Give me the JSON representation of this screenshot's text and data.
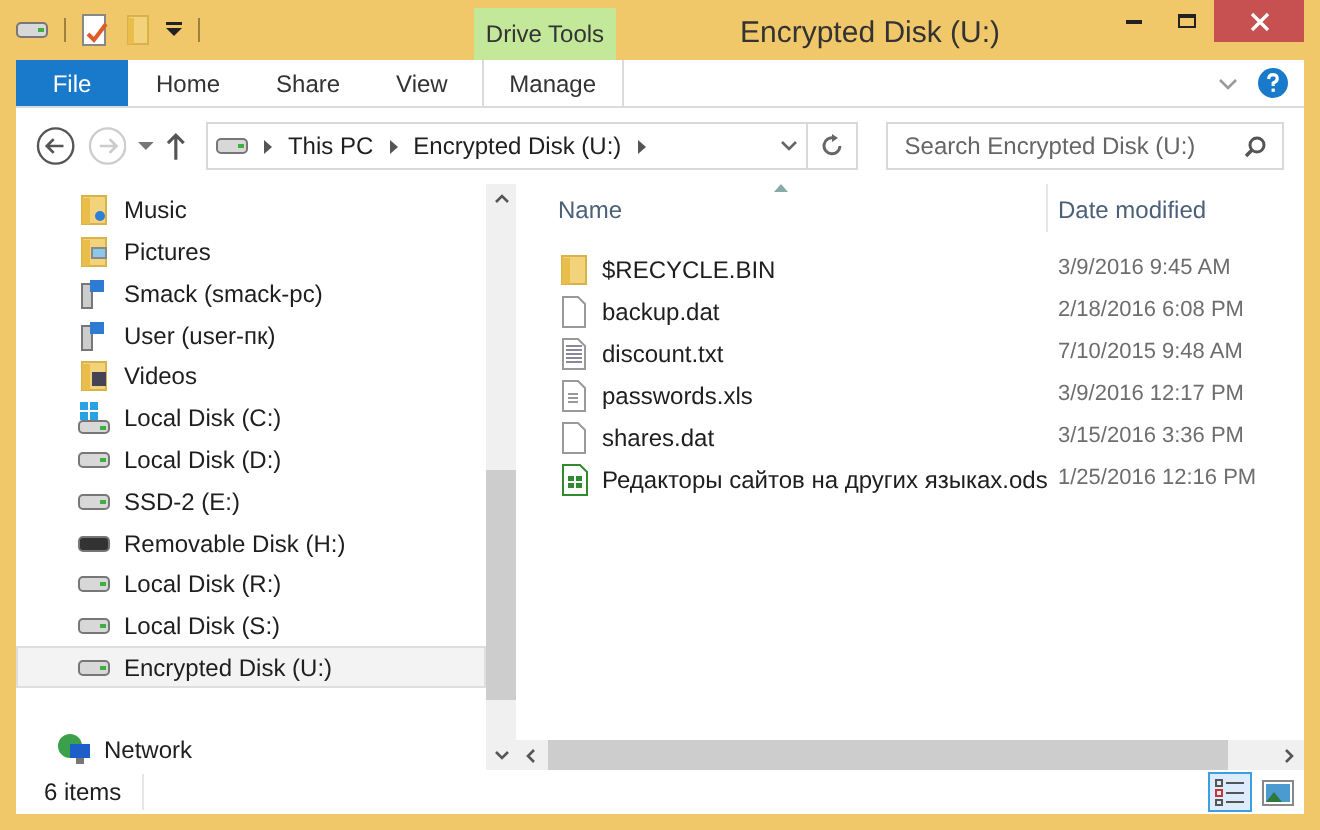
{
  "window": {
    "title": "Encrypted Disk (U:)"
  },
  "ribbon": {
    "context_label": "Drive Tools",
    "tabs": [
      {
        "label": "File",
        "kind": "file"
      },
      {
        "label": "Home",
        "kind": "normal"
      },
      {
        "label": "Share",
        "kind": "normal"
      },
      {
        "label": "View",
        "kind": "normal"
      },
      {
        "label": "Manage",
        "kind": "contextual"
      }
    ]
  },
  "address": {
    "crumbs": [
      "This PC",
      "Encrypted Disk (U:)"
    ]
  },
  "search": {
    "placeholder": "Search Encrypted Disk (U:)"
  },
  "sidebar": {
    "items": [
      {
        "label": "Music",
        "kind": "music",
        "selected": false
      },
      {
        "label": "Pictures",
        "kind": "pictures",
        "selected": false
      },
      {
        "label": "Smack (smack-pc)",
        "kind": "computer",
        "selected": false
      },
      {
        "label": "User (user-пк)",
        "kind": "computer",
        "selected": false
      },
      {
        "label": "Videos",
        "kind": "videos",
        "selected": false
      },
      {
        "label": "Local Disk (C:)",
        "kind": "system",
        "selected": false
      },
      {
        "label": "Local Disk (D:)",
        "kind": "drive",
        "selected": false
      },
      {
        "label": "SSD-2 (E:)",
        "kind": "drive",
        "selected": false
      },
      {
        "label": "Removable Disk (H:)",
        "kind": "removable",
        "selected": false
      },
      {
        "label": "Local Disk (R:)",
        "kind": "drive",
        "selected": false
      },
      {
        "label": "Local Disk (S:)",
        "kind": "drive",
        "selected": false
      },
      {
        "label": "Encrypted Disk (U:)",
        "kind": "drive",
        "selected": true
      }
    ],
    "network": {
      "label": "Network"
    }
  },
  "table": {
    "columns": [
      {
        "label": "Name",
        "sorted": true
      },
      {
        "label": "Date modified",
        "sorted": false
      }
    ],
    "rows": [
      {
        "name": "$RECYCLE.BIN",
        "date": "3/9/2016 9:45 AM",
        "kind": "folder"
      },
      {
        "name": "backup.dat",
        "date": "2/18/2016 6:08 PM",
        "kind": "file"
      },
      {
        "name": "discount.txt",
        "date": "7/10/2015 9:48 AM",
        "kind": "text"
      },
      {
        "name": "passwords.xls",
        "date": "3/9/2016 12:17 PM",
        "kind": "document"
      },
      {
        "name": "shares.dat",
        "date": "3/15/2016 3:36 PM",
        "kind": "file"
      },
      {
        "name": "Редакторы сайтов на других языках.ods",
        "date": "1/25/2016 12:16 PM",
        "kind": "spreadsheet"
      }
    ]
  },
  "status_bar": {
    "text": "6 items",
    "views": [
      {
        "kind": "details",
        "selected": true
      },
      {
        "kind": "large",
        "selected": false
      }
    ]
  }
}
